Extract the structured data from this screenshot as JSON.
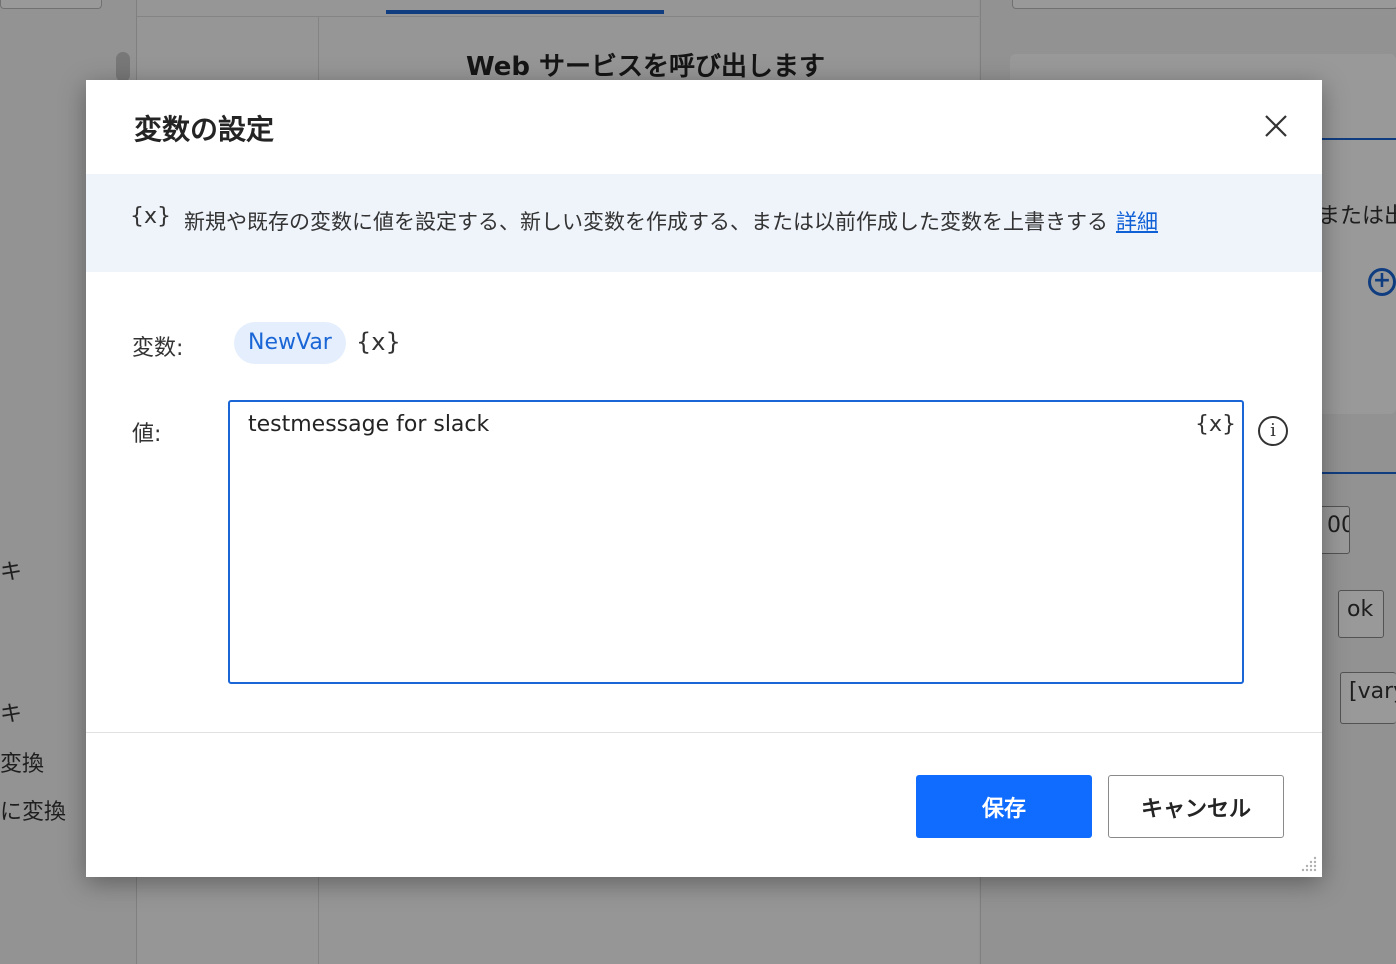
{
  "background": {
    "center_title": "Web サービスを呼び出します",
    "left_items": [
      "キ",
      "キ",
      "変換",
      "に変換"
    ],
    "right_text": "または出",
    "right_field_1": "00",
    "right_field_2": "ok",
    "right_field_3": "[vary"
  },
  "dialog": {
    "title": "変数の設定",
    "info": {
      "icon": "{x}",
      "text": "新規や既存の変数に値を設定する、新しい変数を作成する、または以前作成した変数を上書きする",
      "link": "詳細"
    },
    "variable": {
      "label": "変数:",
      "name": "NewVar",
      "icon": "{x}"
    },
    "value": {
      "label": "値:",
      "text": "testmessage for slack",
      "icon": "{x}",
      "info_icon": "i"
    },
    "buttons": {
      "save": "保存",
      "cancel": "キャンセル"
    }
  },
  "colors": {
    "accent": "#0f6cff",
    "link": "#0f5fd6",
    "info_bg": "#eff4fb",
    "chip_bg": "#e4eefc"
  }
}
